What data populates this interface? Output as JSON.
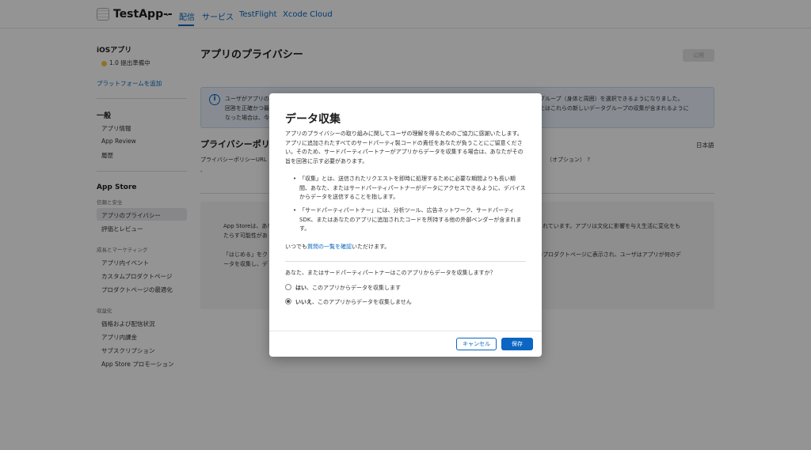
{
  "topbar": {
    "app_title": "TestApp--",
    "nav": [
      "配信",
      "サービス",
      "TestFlight",
      "Xcode Cloud"
    ]
  },
  "sidebar": {
    "platform_heading": "iOSアプリ",
    "version_status": "1.0 提出準備中",
    "add_platform": "プラットフォームを追加",
    "general_heading": "一般",
    "general_items": [
      "アプリ情報",
      "App Review",
      "履歴"
    ],
    "appstore_heading": "App Store",
    "trust_section": "信頼と安全",
    "trust_items": [
      "アプリのプライバシー",
      "評価とレビュー"
    ],
    "growth_section": "成長とマーケティング",
    "growth_items": [
      "アプリ内イベント",
      "カスタムプロダクトページ",
      "プロダクトページの最適化"
    ],
    "monetize_section": "収益化",
    "monetize_items": [
      "価格および配信状況",
      "アプリ内課金",
      "サブスクリプション",
      "App Store プロモーション"
    ]
  },
  "main": {
    "title": "アプリのプライバシー",
    "publish_button": "公開",
    "info_text_left": "ユーザがアプリの",
    "info_text_right_1": "タグループ（身体と周囲）を選択できるようになりました。",
    "info_text_left_2": "回答を正確かつ最",
    "info_text_right_2": "またはこれらの新しいデータグループの収集が含まれるように",
    "info_text_left_3": "なった場合は、今",
    "section_title": "プライバシーポリ",
    "language": "日本語",
    "policy_url_label": "プライバシーポリシーURL",
    "policy_dash": "-",
    "optional_label": "（オプション）",
    "gray_text_1": "App Storeは、あな",
    "gray_text_1r": "されています。アプリは文化に影響を与え生活に変化をも",
    "gray_text_2": "たらす可能性があ",
    "gray_text_3": "「はじめる」をク",
    "gray_text_3r": "のプロダクトページに表示され、ユーザはアプリが何のデ",
    "gray_text_4": "ータを収集し、デ"
  },
  "modal": {
    "title": "データ収集",
    "intro": "アプリのプライバシーの取り組みに関してユーザの理解を得るためのご協力に感謝いたします。アプリに追加されたすべてのサードパーティ製コードの責任をあなたが負うことにご留意ください。そのため、サードパーティパートナーがアプリからデータを収集する場合は、あなたがその旨を回答に示す必要があります。",
    "bullet_1": "「収集」とは、送信されたリクエストを即時に処理するために必要な期間よりも長い期間、あなた、またはサードパーティパートナーがデータにアクセスできるように、デバイスからデータを送信することを指します。",
    "bullet_2": "「サードパーティパートナー」には、分析ツール、広告ネットワーク、サードパーティSDK、またはあなたのアプリに追加されたコードを所持する他の外部ベンダーが含まれます。",
    "faq_prefix": "いつでも",
    "faq_link": "質問の一覧を確認",
    "faq_suffix": "いただけます。",
    "question": "あなた、またはサードパーティパートナーはこのアプリからデータを収集しますか？",
    "option_yes_bold": "はい",
    "option_yes_rest": "、このアプリからデータを収集します",
    "option_no_bold": "いいえ",
    "option_no_rest": "、このアプリからデータを収集しません",
    "selected_option": "no",
    "cancel_button": "キャンセル",
    "save_button": "保存"
  }
}
